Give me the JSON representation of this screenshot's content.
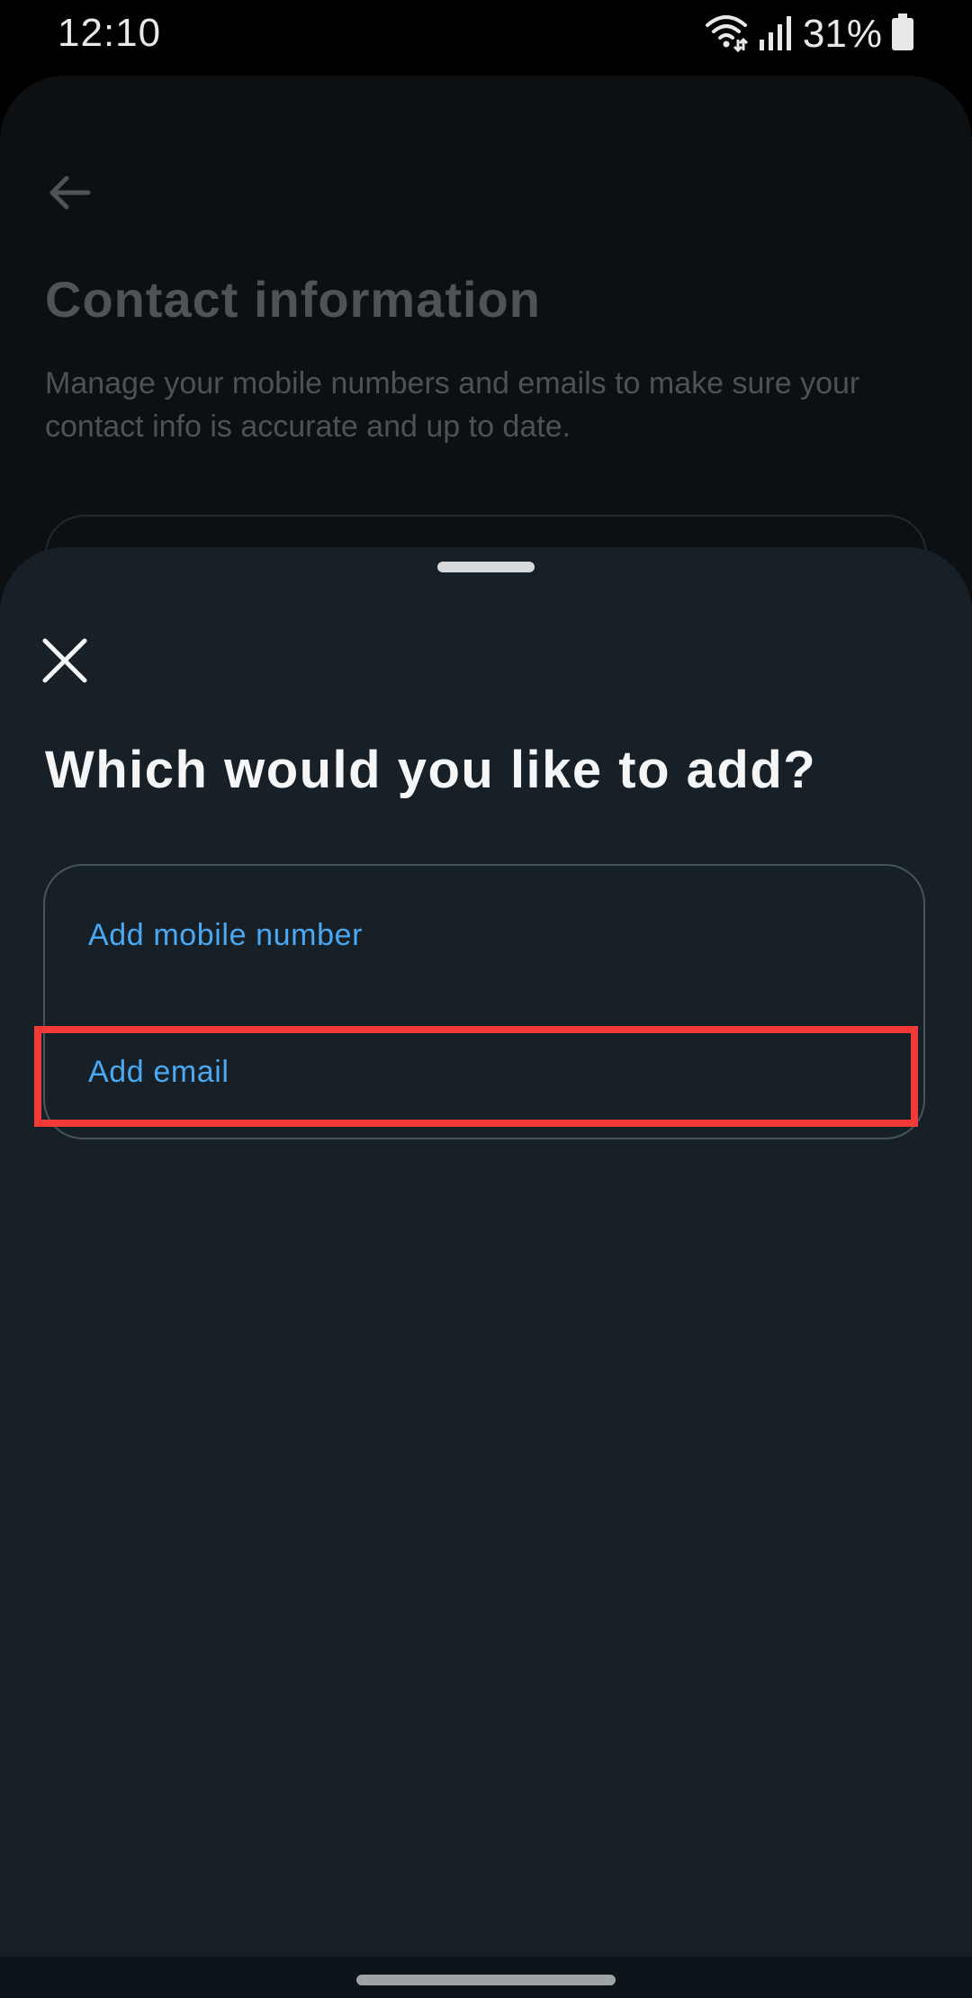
{
  "status_bar": {
    "time": "12:10",
    "battery_percent": "31%",
    "icons": [
      "wifi-icon",
      "signal-icon",
      "battery-icon"
    ]
  },
  "background_page": {
    "title": "Contact information",
    "description": "Manage your mobile numbers and emails to make sure your contact info is accurate and up to date.",
    "back_icon": "back-arrow-icon"
  },
  "sheet": {
    "close_icon": "close-icon",
    "title": "Which would you like to add?",
    "options": [
      {
        "label": "Add mobile number"
      },
      {
        "label": "Add email"
      }
    ]
  },
  "colors": {
    "sheet_background": "#172027",
    "link_blue": "#4aa9f2",
    "highlight_red": "#f23b36"
  }
}
